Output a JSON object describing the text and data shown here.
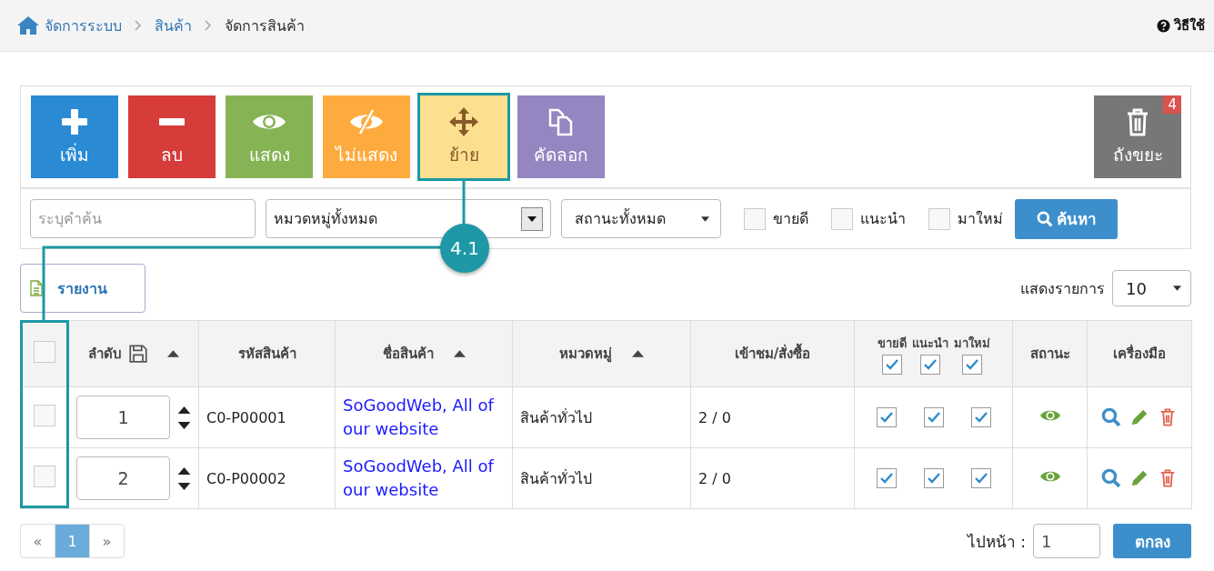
{
  "breadcrumb": {
    "items": [
      {
        "kind": "home",
        "label": "จัดการระบบ"
      },
      {
        "kind": "link",
        "label": "สินค้า"
      },
      {
        "kind": "current",
        "label": "จัดการสินค้า"
      }
    ],
    "help": "วิธีใช้"
  },
  "toolbar": {
    "buttons": [
      {
        "kind": "add",
        "label": "เพิ่ม",
        "color": "#2a8ad4",
        "highlighted": false
      },
      {
        "kind": "delete",
        "label": "ลบ",
        "color": "#d63c3a",
        "highlighted": false
      },
      {
        "kind": "show",
        "label": "แสดง",
        "color": "#86b455",
        "highlighted": false
      },
      {
        "kind": "hide",
        "label": "ไม่แสดง",
        "color": "#fdab3e",
        "highlighted": false
      },
      {
        "kind": "move",
        "label": "ย้าย",
        "color": "#fce08f",
        "highlighted": true
      },
      {
        "kind": "copy",
        "label": "คัดลอก",
        "color": "#9585c0",
        "highlighted": false
      }
    ],
    "trash": {
      "label": "ถังขยะ",
      "badge": "4"
    }
  },
  "filters": {
    "search": {
      "placeholder": "ระบุคำค้น"
    },
    "category": "หมวดหมู่ทั้งหมด",
    "status": "สถานะทั้งหมด",
    "checkboxes": [
      {
        "label": "ขายดี",
        "checked": false
      },
      {
        "label": "แนะนำ",
        "checked": false
      },
      {
        "label": "มาใหม่",
        "checked": false
      }
    ],
    "search_button": "ค้นหา"
  },
  "annotation": {
    "label": "4.1"
  },
  "report_button": "รายงาน",
  "page_size": {
    "label": "แสดงรายการ",
    "value": "10"
  },
  "table": {
    "select_all": {
      "checked": false
    },
    "columns": [
      {
        "kind": "order",
        "label": "ลำดับ",
        "sortable": true
      },
      {
        "kind": "text",
        "label": "รหัสสินค้า",
        "sortable": false
      },
      {
        "kind": "text",
        "label": "ชื่อสินค้า",
        "sortable": true
      },
      {
        "kind": "text",
        "label": "หมวดหมู่",
        "sortable": true
      },
      {
        "kind": "text",
        "label": "เข้าชม/สั่งซื้อ",
        "sortable": false
      },
      {
        "kind": "flags",
        "flags": [
          {
            "label": "ขายดี",
            "checked": true
          },
          {
            "label": "แนะนำ",
            "checked": true
          },
          {
            "label": "มาใหม่",
            "checked": true
          }
        ]
      },
      {
        "kind": "text",
        "label": "สถานะ",
        "sortable": false
      },
      {
        "kind": "text",
        "label": "เครื่องมือ",
        "sortable": false
      }
    ],
    "rows": [
      {
        "selected": false,
        "order": "1",
        "code": "C0-P00001",
        "name": "SoGoodWeb, All of our website",
        "category": "สินค้าทั่วไป",
        "views": "2 / 0",
        "flags": [
          true,
          true,
          true
        ],
        "visible": true
      },
      {
        "selected": false,
        "order": "2",
        "code": "C0-P00002",
        "name": "SoGoodWeb, All of our website",
        "category": "สินค้าทั่วไป",
        "views": "2 / 0",
        "flags": [
          true,
          true,
          true
        ],
        "visible": true
      }
    ]
  },
  "pagination": {
    "pages": [
      {
        "label": "«",
        "selected": false
      },
      {
        "label": "1",
        "selected": true
      },
      {
        "label": "»",
        "selected": false
      }
    ],
    "goto_label": "ไปหน้า :",
    "goto_value": "1",
    "goto_button": "ตกลง"
  }
}
